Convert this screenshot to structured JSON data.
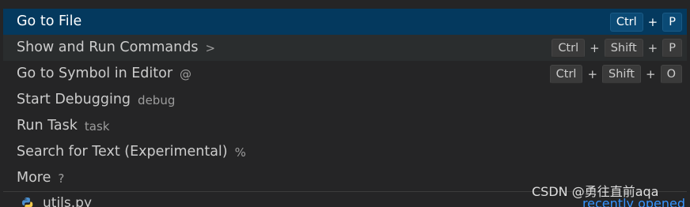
{
  "palette": {
    "items": [
      {
        "label": "Go to File",
        "hint": "",
        "keys": [
          "Ctrl",
          "P"
        ],
        "state": "selected"
      },
      {
        "label": "Show and Run Commands",
        "hint": ">",
        "keys": [
          "Ctrl",
          "Shift",
          "P"
        ],
        "state": "hovered"
      },
      {
        "label": "Go to Symbol in Editor",
        "hint": "@",
        "keys": [
          "Ctrl",
          "Shift",
          "O"
        ],
        "state": ""
      },
      {
        "label": "Start Debugging",
        "hint": "debug",
        "keys": [],
        "state": ""
      },
      {
        "label": "Run Task",
        "hint": "task",
        "keys": [],
        "state": ""
      },
      {
        "label": "Search for Text (Experimental)",
        "hint": "%",
        "keys": [],
        "state": ""
      },
      {
        "label": "More",
        "hint": "?",
        "keys": [],
        "state": ""
      }
    ],
    "key_separator": "+"
  },
  "recent_file": {
    "name": "utils.py",
    "icon": "python-file-icon",
    "tag": "recently opened"
  },
  "watermark": "CSDN @勇往直前aqa",
  "colors": {
    "background": "#252526",
    "selected": "#04395e",
    "hovered": "#2a2d2e",
    "link": "#3794ff"
  }
}
